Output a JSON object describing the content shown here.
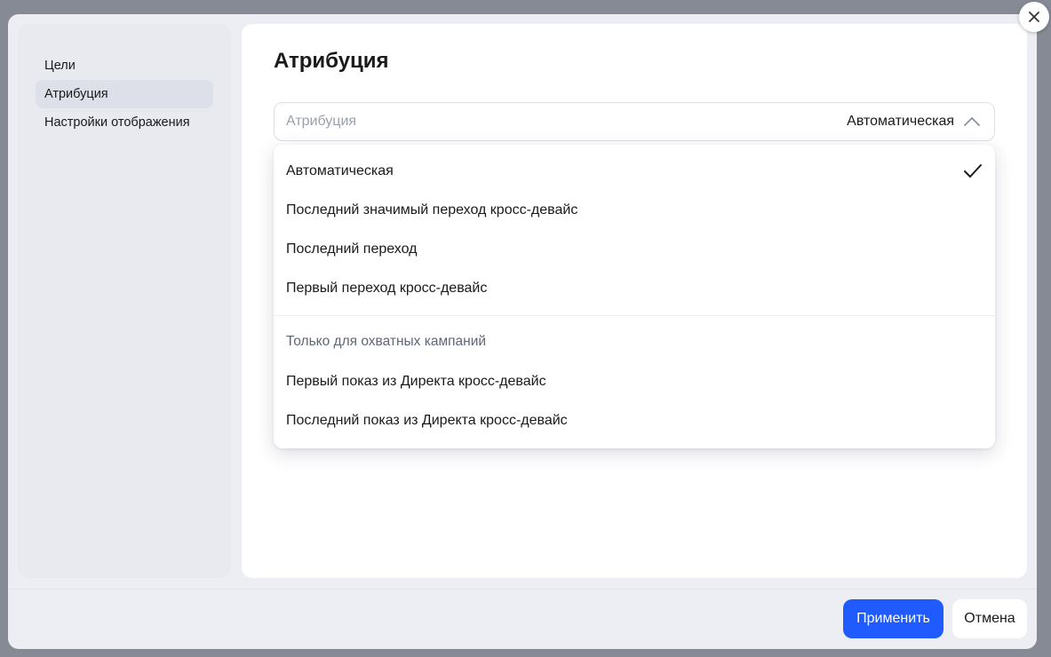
{
  "sidebar": {
    "items": [
      {
        "label": "Цели"
      },
      {
        "label": "Атрибуция"
      },
      {
        "label": "Настройки отображения"
      }
    ]
  },
  "main": {
    "title": "Атрибуция",
    "select": {
      "label": "Атрибуция",
      "value": "Автоматическая",
      "chevron_icon": "chevron-up-icon"
    },
    "dropdown": {
      "options": [
        {
          "label": "Автоматическая",
          "selected": true
        },
        {
          "label": "Последний значимый переход кросс-девайс"
        },
        {
          "label": "Последний переход"
        },
        {
          "label": "Первый переход кросс-девайс"
        }
      ],
      "section_header": "Только для охватных кампаний",
      "section_options": [
        {
          "label": "Первый показ из Директа кросс-девайс"
        },
        {
          "label": "Последний показ из Директа кросс-девайс"
        }
      ],
      "check_icon": "checkmark-icon"
    }
  },
  "footer": {
    "apply_label": "Применить",
    "cancel_label": "Отмена"
  },
  "close_icon": "close-icon",
  "colors": {
    "accent": "#1f5bff",
    "overlay": "#5c6270",
    "active_nav": "#dde0e8"
  }
}
